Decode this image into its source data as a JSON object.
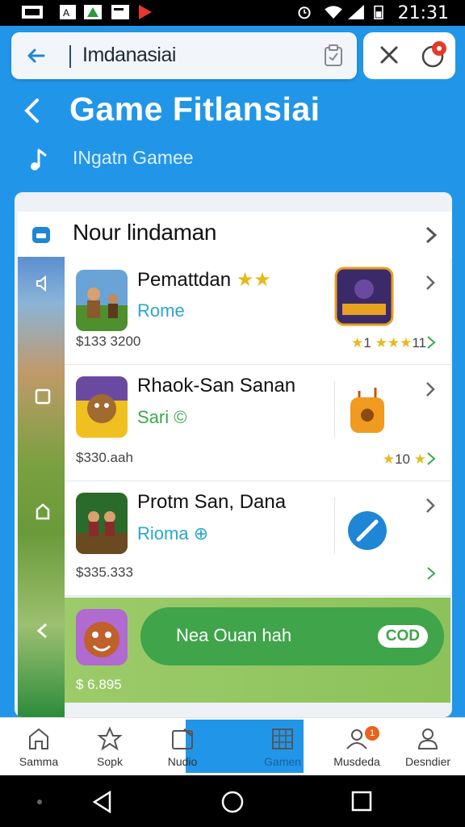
{
  "status_bar": {
    "time": "21:31"
  },
  "search": {
    "value": "Imdanasiai"
  },
  "header": {
    "title": "Game Fitlansiai",
    "subtitle": "INgatn Gamee"
  },
  "section": {
    "title": "Nour lindaman"
  },
  "games": [
    {
      "name": "Pemattdan",
      "subtitle": "Rome",
      "price": "$133 3200",
      "rating": "1",
      "rating_count": "11"
    },
    {
      "name": "Rhaok-San Sanan",
      "subtitle": "Sari",
      "price": "$330.aah",
      "rating": "10",
      "rating_count": ""
    },
    {
      "name": "Protm San, Dana",
      "subtitle": "Rioma",
      "price": "$335.333",
      "rating": "",
      "rating_count": ""
    }
  ],
  "promo": {
    "button_label": "Nea Ouan hah",
    "pill": "COD",
    "price": "$ 6.895"
  },
  "nav": {
    "items": [
      {
        "label": "Samma",
        "icon": "home-icon"
      },
      {
        "label": "Sopk",
        "icon": "star-icon"
      },
      {
        "label": "Nudio",
        "icon": "inbox-icon"
      },
      {
        "label": "Gamen",
        "icon": "grid-icon"
      },
      {
        "label": "Musdeda",
        "icon": "people-icon",
        "badge": "1"
      },
      {
        "label": "Desndier",
        "icon": "person-icon"
      }
    ]
  },
  "colors": {
    "primary": "#2196e8",
    "accent_green": "#3fa44a",
    "star": "#e8b91a"
  }
}
